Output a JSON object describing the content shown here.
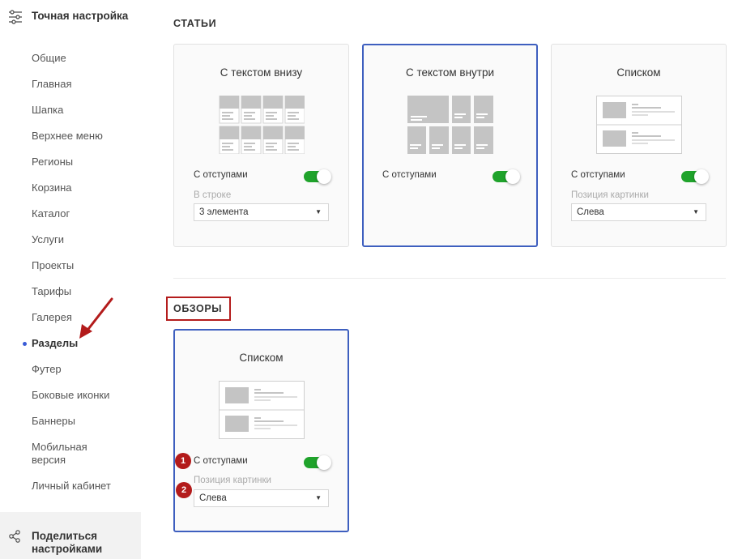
{
  "sidebar": {
    "title": "Точная настройка",
    "items": [
      {
        "label": "Общие"
      },
      {
        "label": "Главная"
      },
      {
        "label": "Шапка"
      },
      {
        "label": "Верхнее меню"
      },
      {
        "label": "Регионы"
      },
      {
        "label": "Корзина"
      },
      {
        "label": "Каталог"
      },
      {
        "label": "Услуги"
      },
      {
        "label": "Проекты"
      },
      {
        "label": "Тарифы"
      },
      {
        "label": "Галерея"
      },
      {
        "label": "Разделы",
        "active": true
      },
      {
        "label": "Футер"
      },
      {
        "label": "Боковые иконки"
      },
      {
        "label": "Баннеры"
      },
      {
        "label": "Мобильная версия"
      },
      {
        "label": "Личный кабинет"
      }
    ],
    "share_label": "Поделиться настройками"
  },
  "articles": {
    "section_title": "СТАТЬИ",
    "cards": [
      {
        "title": "С текстом внизу",
        "selected": false,
        "toggle_label": "С отступами",
        "toggle_on": true,
        "select_label": "В строке",
        "select_value": "3 элемента"
      },
      {
        "title": "С текстом внутри",
        "selected": true,
        "toggle_label": "С отступами",
        "toggle_on": true
      },
      {
        "title": "Списком",
        "selected": false,
        "toggle_label": "С отступами",
        "toggle_on": true,
        "select_label": "Позиция картинки",
        "select_value": "Слева"
      }
    ]
  },
  "reviews": {
    "section_title": "ОБЗОРЫ",
    "card": {
      "title": "Списком",
      "selected": true,
      "toggle_label": "С отступами",
      "toggle_on": true,
      "select_label": "Позиция картинки",
      "select_value": "Слева"
    },
    "badges": [
      "1",
      "2"
    ]
  },
  "colors": {
    "accent": "#3e5fbf",
    "toggle_on": "#1fa32b",
    "annotation": "#b31b1b",
    "active_dot": "#3a5bd6"
  },
  "icons": {
    "settings": "sliders-icon",
    "share": "share-icon",
    "dropdown": "triangle-down"
  }
}
